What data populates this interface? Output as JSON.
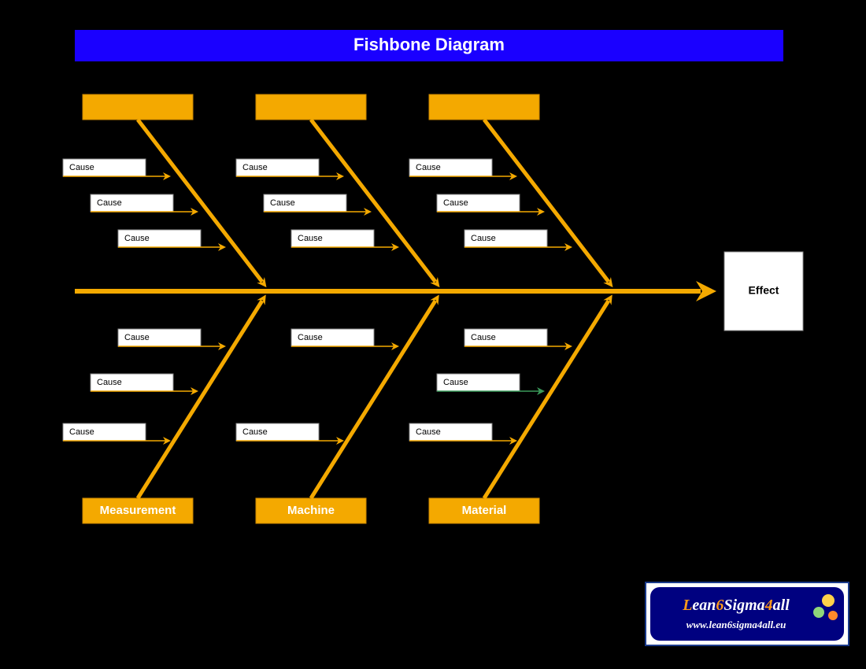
{
  "title": "Fishbone Diagram",
  "effect": "Effect",
  "categories_top": [
    "",
    "",
    ""
  ],
  "categories_bottom": [
    "Measurement",
    "Machine",
    "Material"
  ],
  "cause_label": "Cause",
  "logo": {
    "line1": "Lean6Sigma4all",
    "line2": "www.lean6sigma4all.eu"
  }
}
